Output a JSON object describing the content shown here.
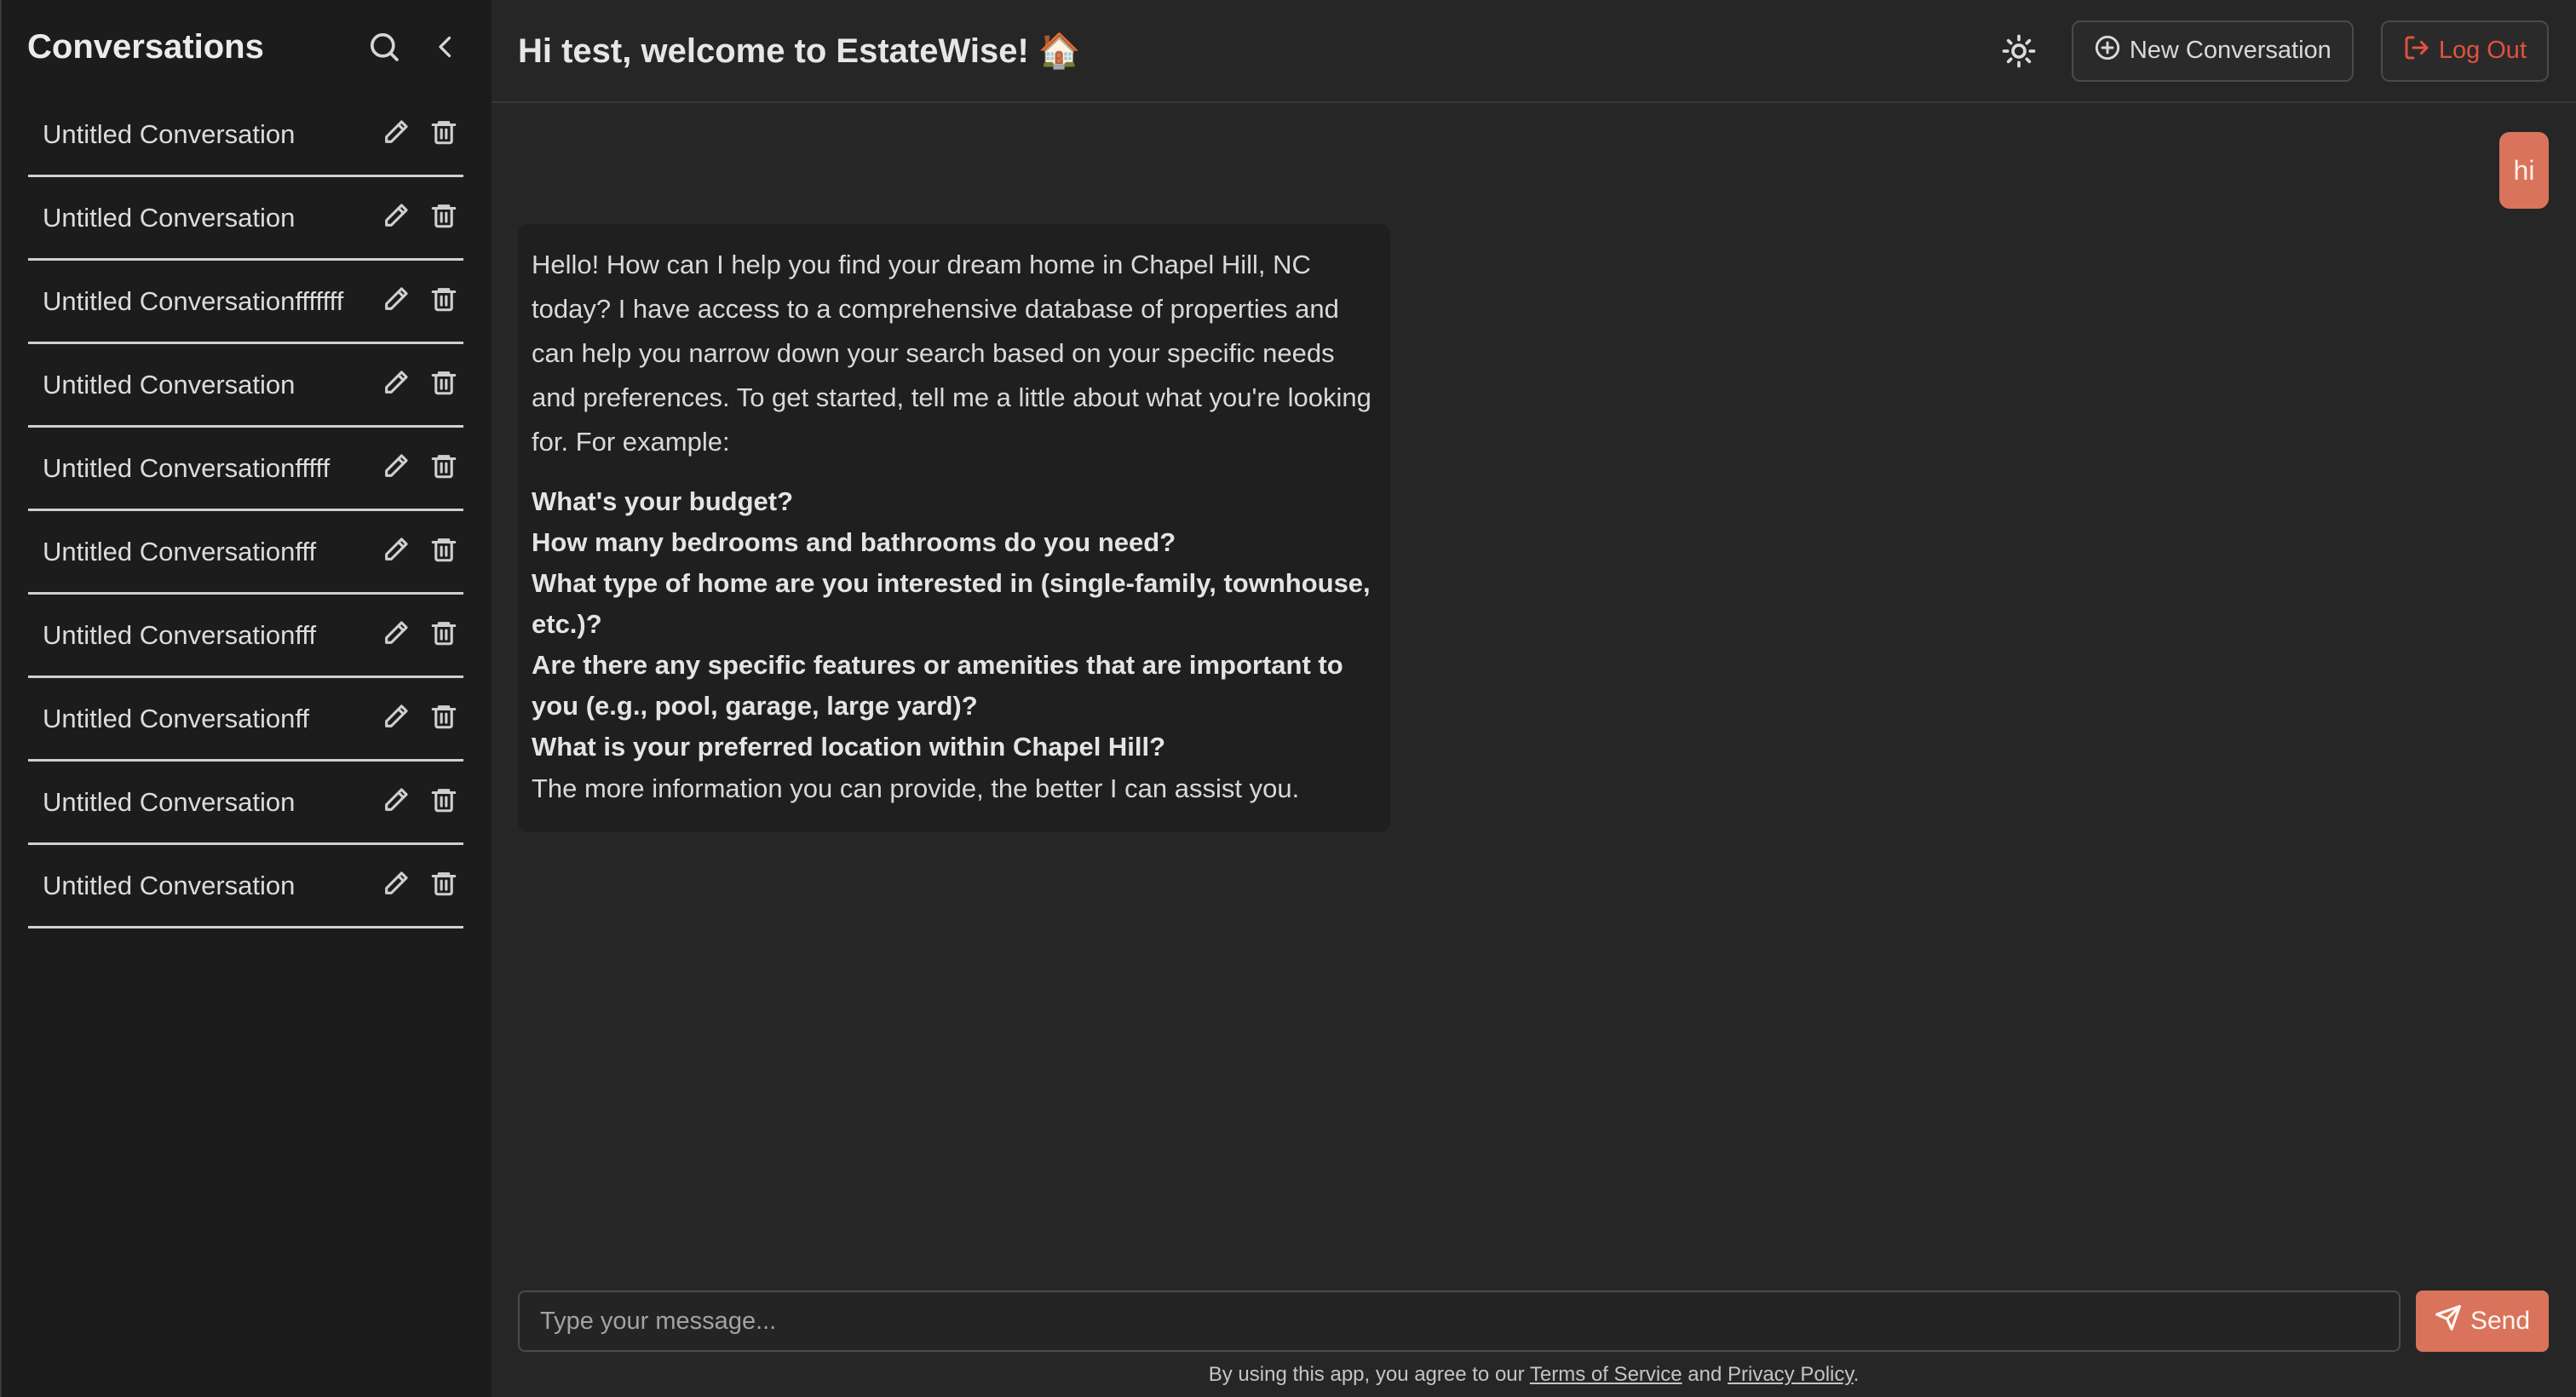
{
  "sidebar": {
    "title": "Conversations",
    "items": [
      {
        "label": "Untitled Conversation"
      },
      {
        "label": "Untitled Conversation"
      },
      {
        "label": "Untitled Conversationfffffff"
      },
      {
        "label": "Untitled Conversation"
      },
      {
        "label": "Untitled Conversationfffff"
      },
      {
        "label": "Untitled Conversationfff"
      },
      {
        "label": "Untitled Conversationfff"
      },
      {
        "label": "Untitled Conversationff"
      },
      {
        "label": "Untitled Conversation"
      },
      {
        "label": "Untitled Conversation"
      }
    ]
  },
  "header": {
    "welcome": "Hi test, welcome to EstateWise! 🏠",
    "new_conversation": "New Conversation",
    "logout": "Log Out"
  },
  "chat": {
    "user_message": "hi",
    "bot_intro": "Hello! How can I help you find your dream home in Chapel Hill, NC today? I have access to a comprehensive database of properties and can help you narrow down your search based on your specific needs and preferences. To get started, tell me a little about what you're looking for. For example:",
    "bot_questions": [
      "What's your budget?",
      "How many bedrooms and bathrooms do you need?",
      "What type of home are you interested in (single-family, townhouse, etc.)?",
      "Are there any specific features or amenities that are important to you (e.g., pool, garage, large yard)?",
      "What is your preferred location within Chapel Hill?"
    ],
    "bot_outro": "The more information you can provide, the better I can assist you."
  },
  "composer": {
    "placeholder": "Type your message...",
    "send": "Send"
  },
  "footer": {
    "prefix": "By using this app, you agree to our ",
    "terms": "Terms of Service",
    "and": " and ",
    "privacy": "Privacy Policy",
    "suffix": "."
  },
  "colors": {
    "accent": "#d9735b",
    "danger": "#e0533f",
    "sidebar_bg": "#1c1c1c",
    "main_bg": "#262626"
  }
}
